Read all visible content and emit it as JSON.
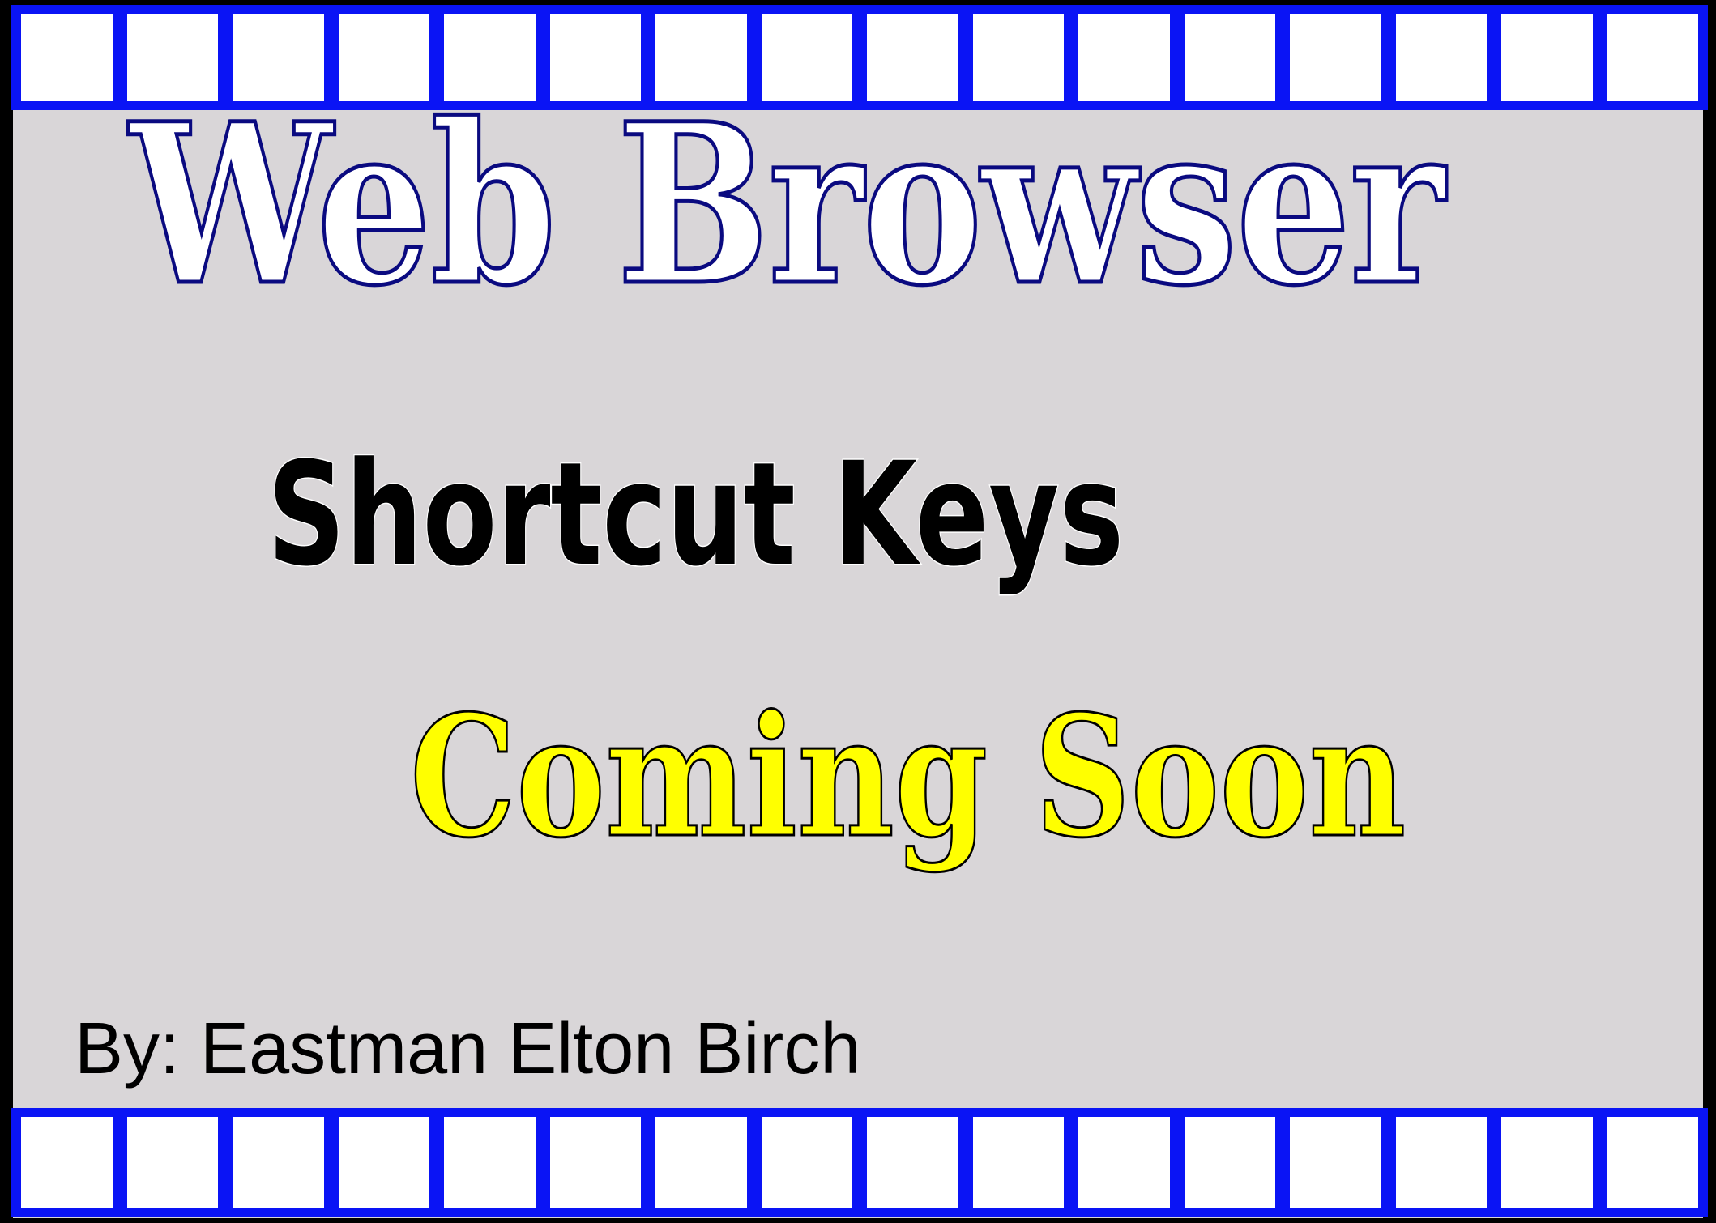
{
  "title": "Web Browser",
  "subtitle": "Shortcut Keys",
  "status": "Coming Soon",
  "byline": "By: Eastman Elton Birch",
  "colors": {
    "background": "#d9d6d8",
    "film_strip": "#0a14f5",
    "frame": "#ffffff",
    "title_fill": "#ffffff",
    "title_outline": "#0a0a80",
    "subtitle_fill": "#000000",
    "status_fill": "#ffff00"
  },
  "film_strip": {
    "frames_per_strip": 16
  }
}
